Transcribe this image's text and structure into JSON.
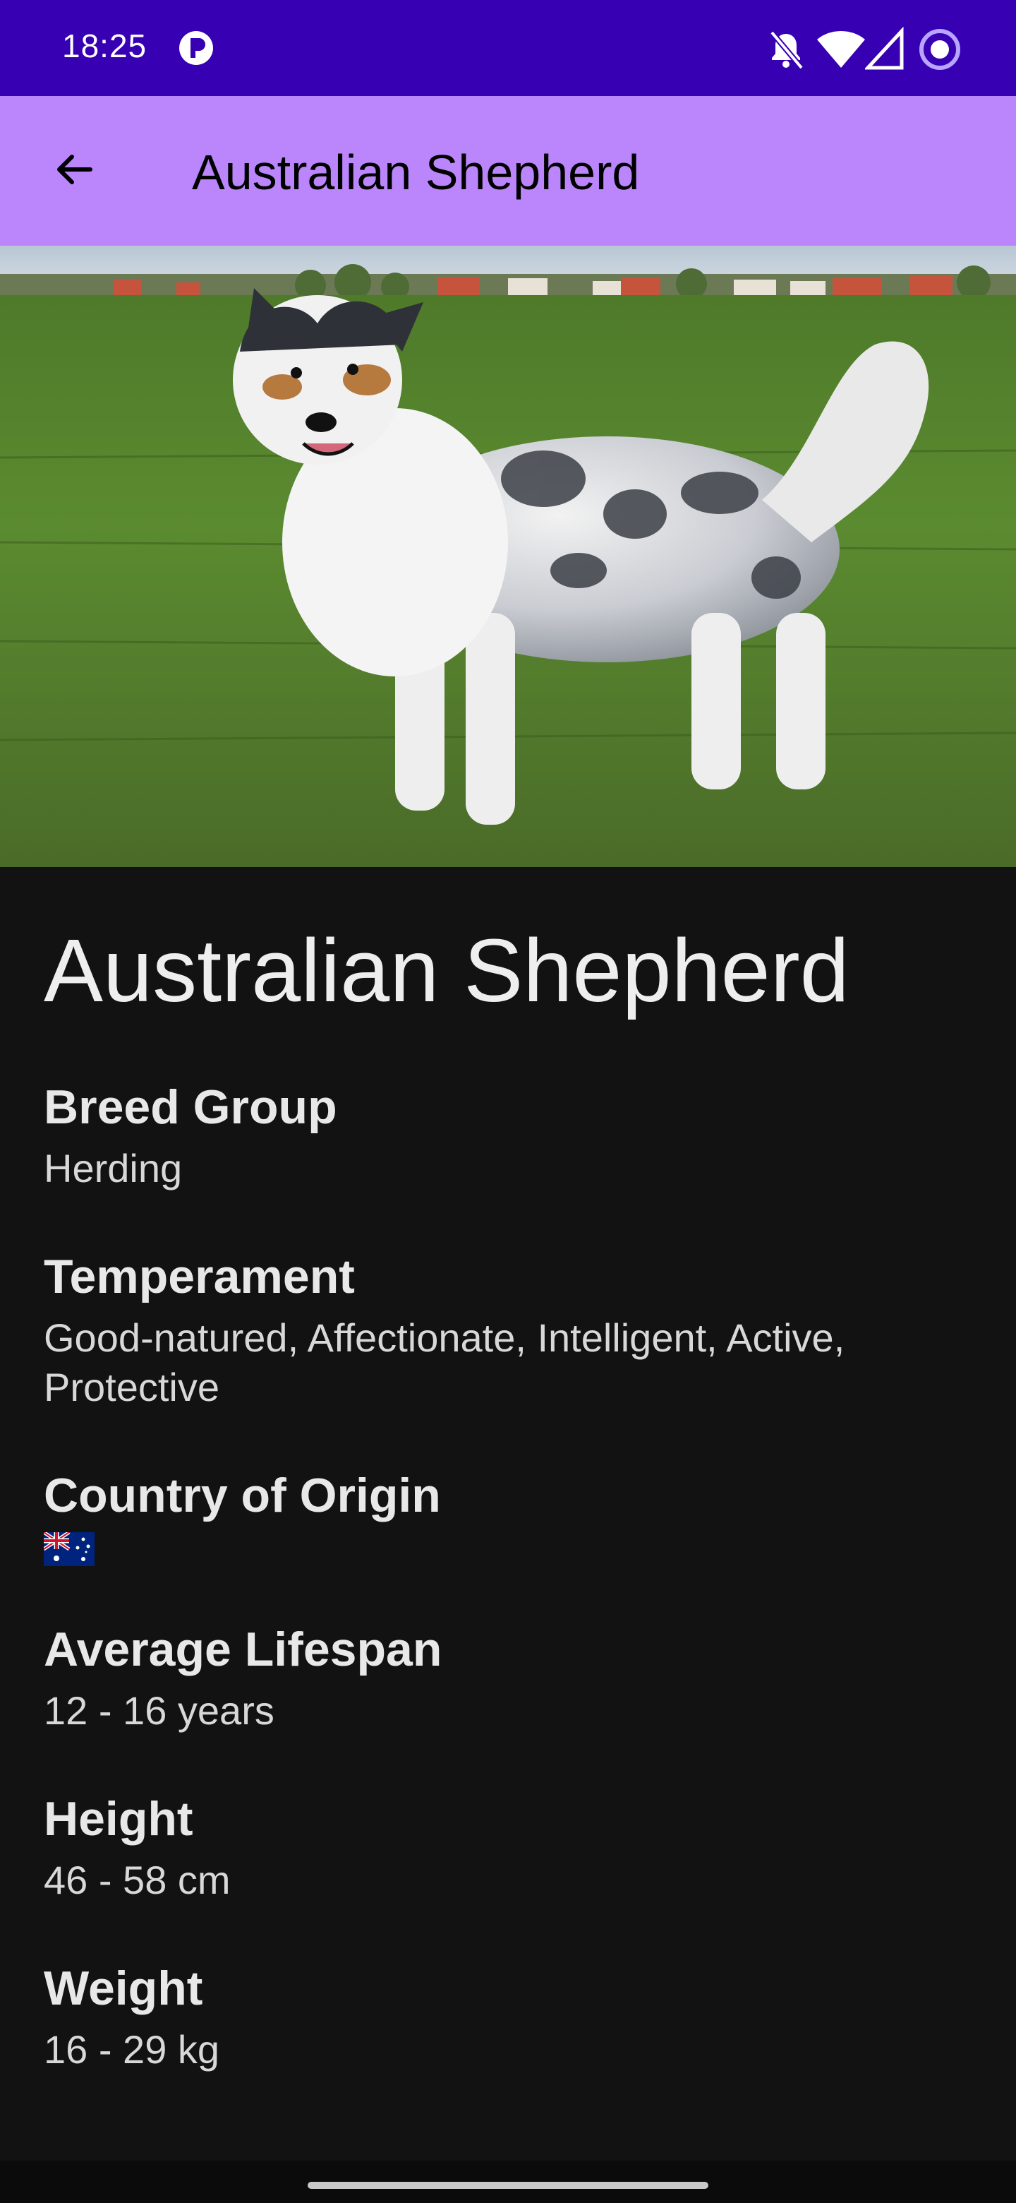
{
  "status_bar": {
    "time": "18:25",
    "icons": [
      "app-notification-icon",
      "notifications-off-icon",
      "wifi-icon",
      "signal-icon",
      "screen-record-icon"
    ]
  },
  "app_bar": {
    "back_icon": "arrow-back-icon",
    "title": "Australian Shepherd"
  },
  "hero_image": {
    "subject": "dog"
  },
  "breed": {
    "name": "Australian Shepherd",
    "sections": [
      {
        "label": "Breed Group",
        "value": "Herding"
      },
      {
        "label": "Temperament",
        "value": "Good-natured, Affectionate, Intelligent, Active, Protective"
      },
      {
        "label": "Country of Origin",
        "value_icon": "australia-flag-icon"
      },
      {
        "label": "Average Lifespan",
        "value": "12 - 16 years"
      },
      {
        "label": "Height",
        "value": "46 - 58 cm"
      },
      {
        "label": "Weight",
        "value": "16 - 29 kg"
      }
    ]
  },
  "colors": {
    "status_bar": "#3700b3",
    "app_bar": "#bb86fc",
    "background": "#121212"
  }
}
